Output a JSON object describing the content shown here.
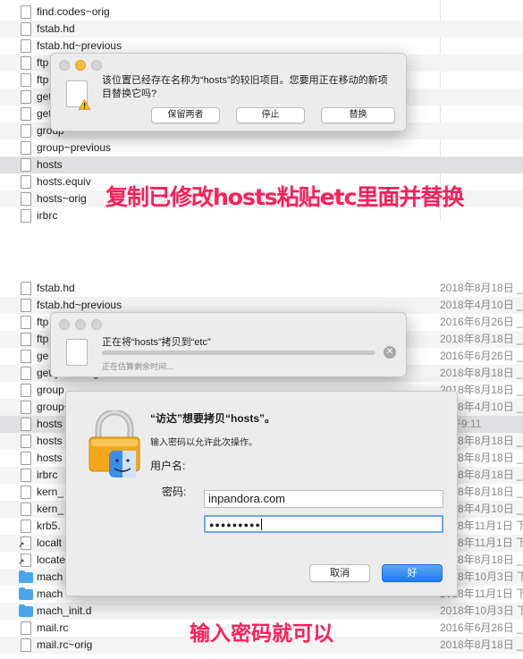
{
  "top_list": {
    "rows": [
      {
        "name": "find.codes~orig",
        "sel": false
      },
      {
        "name": "fstab.hd",
        "sel": false
      },
      {
        "name": "fstab.hd~previous",
        "sel": false
      },
      {
        "name": "ftp",
        "sel": false
      },
      {
        "name": "ftp",
        "sel": false
      },
      {
        "name": "get",
        "sel": false
      },
      {
        "name": "get",
        "sel": false
      },
      {
        "name": "group",
        "sel": false
      },
      {
        "name": "group~previous",
        "sel": false
      },
      {
        "name": "hosts",
        "sel": true
      },
      {
        "name": "hosts.equiv",
        "sel": false
      },
      {
        "name": "hosts~orig",
        "sel": false
      },
      {
        "name": "irbrc",
        "sel": false
      }
    ]
  },
  "replace_dialog": {
    "message": "该位置已经存在名称为“hosts”的较旧项目。您要用正在移动的新项目替换它吗?",
    "keep_both_label": "保留两者",
    "stop_label": "停止",
    "replace_label": "替换"
  },
  "caption_top": "复制已修改hosts粘贴etc里面并替换",
  "bottom_list": {
    "rows": [
      {
        "name": "fstab.hd",
        "date": "2018年8月18日 _",
        "icon": "file",
        "sel": false
      },
      {
        "name": "fstab.hd~previous",
        "date": "2018年4月10日 _",
        "icon": "file",
        "sel": false
      },
      {
        "name": "ftp",
        "date": "2016年6月26日 _",
        "icon": "file",
        "sel": false
      },
      {
        "name": "ftp",
        "date": "2018年8月18日 _",
        "icon": "file",
        "sel": false
      },
      {
        "name": "ge",
        "date": "2016年6月26日 _",
        "icon": "file",
        "sel": false
      },
      {
        "name": "gettytab~orig",
        "date": "2018年8月18日 _",
        "icon": "file",
        "sel": false
      },
      {
        "name": "group",
        "date": "2018年8月18日 _",
        "icon": "file",
        "sel": false
      },
      {
        "name": "group~previous",
        "date": "2018年4月10日 _",
        "icon": "file",
        "sel": false
      },
      {
        "name": "hosts",
        "date": "上午9:11",
        "icon": "file",
        "sel": true
      },
      {
        "name": "hosts",
        "date": "2018年8月18日 _",
        "icon": "file",
        "sel": false
      },
      {
        "name": "hosts",
        "date": "2018年8月18日 _",
        "icon": "file",
        "sel": false
      },
      {
        "name": "irbrc",
        "date": "2018年8月18日 _",
        "icon": "file",
        "sel": false
      },
      {
        "name": "kern_",
        "date": "2018年8月18日 _",
        "icon": "file",
        "sel": false
      },
      {
        "name": "kern_",
        "date": "2018年4月10日 _",
        "icon": "file",
        "sel": false
      },
      {
        "name": "krb5.",
        "date": "2018年11月1日 下",
        "icon": "file",
        "sel": false
      },
      {
        "name": "localt",
        "date": "2018年11月1日 下",
        "icon": "alias",
        "sel": false
      },
      {
        "name": "locate",
        "date": "2018年8月18日 _",
        "icon": "alias",
        "sel": false
      },
      {
        "name": "mach",
        "date": "2018年10月3日 下",
        "icon": "folder",
        "sel": false
      },
      {
        "name": "mach",
        "date": "2018年11月1日 下",
        "icon": "folder",
        "sel": false
      },
      {
        "name": "mach_init.d",
        "date": "2018年10月3日 下",
        "icon": "folder",
        "sel": false
      },
      {
        "name": "mail.rc",
        "date": "2016年6月26日 _",
        "icon": "file",
        "sel": false
      },
      {
        "name": "mail.rc~orig",
        "date": "2018年8月18日 _",
        "icon": "file",
        "sel": false
      }
    ]
  },
  "copy_dialog": {
    "title": "正在将“hosts”拷贝到“etc”",
    "status": "正在估算剩余时间...",
    "progress": 0.0
  },
  "auth_dialog": {
    "title": "“访达”想要拷贝“hosts”。",
    "subtitle": "输入密码以允许此次操作。",
    "username_label": "用户名:",
    "username_value": "inpandora.com",
    "password_label": "密码:",
    "password_value": "●●●●●●●●●",
    "cancel_label": "取消",
    "ok_label": "好"
  },
  "caption_bottom": "输入密码就可以",
  "colors": {
    "caption": "#ff1f59",
    "primary_button": "#1f7cef",
    "lock_gold": "#f3a81c",
    "finder_blue": "#3d8de8"
  }
}
